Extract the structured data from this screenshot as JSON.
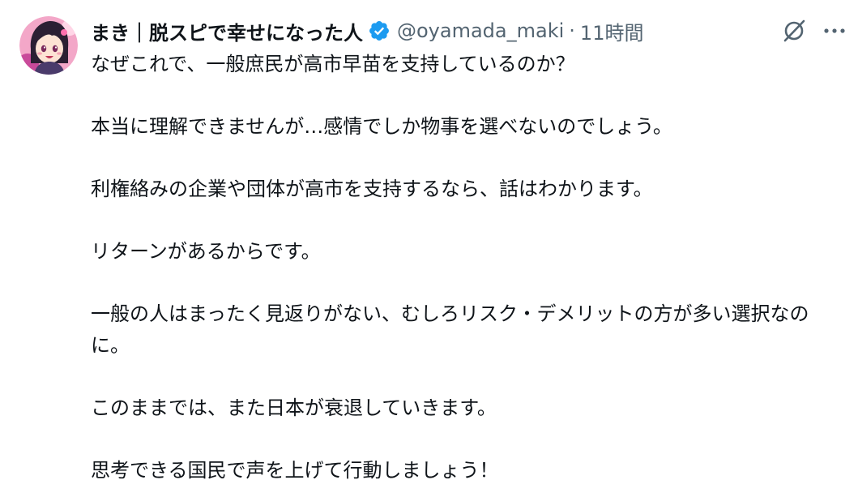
{
  "author": {
    "display_name": "まき｜脱スピで幸せになった人",
    "handle": "@oyamada_maki",
    "separator": "·",
    "time": "11時間",
    "avatar_icon": "anime-girl-avatar-icon",
    "verified_icon": "verified-badge-icon"
  },
  "actions": {
    "grok_icon": "grok-icon",
    "more_icon": "more-horizontal-icon"
  },
  "tweet": {
    "paragraphs": [
      "なぜこれで、一般庶民が高市早苗を支持しているのか？",
      "本当に理解できませんが…感情でしか物事を選べないのでしょう。",
      "利権絡みの企業や団体が高市を支持するなら、話はわかります。",
      "リターンがあるからです。",
      "一般の人はまったく見返りがない、むしろリスク・デメリットの方が多い選択なのに。",
      "このままでは、また日本が衰退していきます。",
      "思考できる国民で声を上げて行動しましょう！"
    ]
  },
  "colors": {
    "text_primary": "#0f1419",
    "text_secondary": "#536471",
    "verified_blue": "#1d9bf0",
    "background": "#ffffff"
  }
}
